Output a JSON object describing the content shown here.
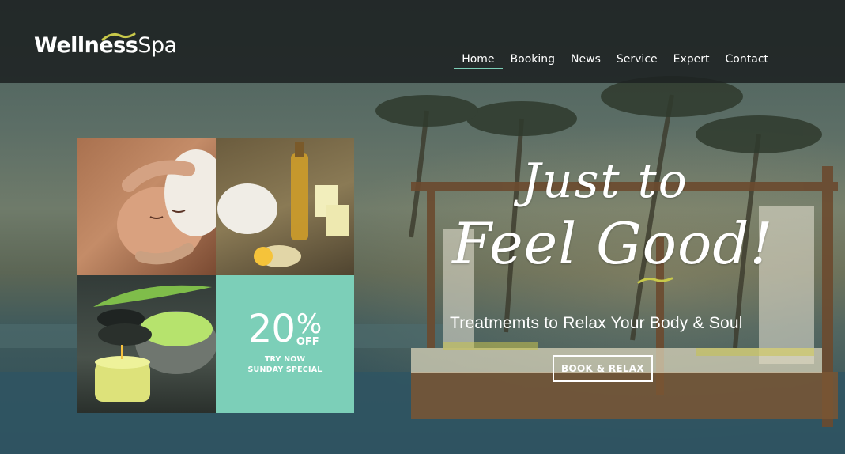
{
  "header": {
    "logo": {
      "bold": "Wellness",
      "light": "Spa"
    },
    "nav": [
      {
        "label": "Home",
        "active": true
      },
      {
        "label": "Booking",
        "active": false
      },
      {
        "label": "News",
        "active": false
      },
      {
        "label": "Service",
        "active": false
      },
      {
        "label": "Expert",
        "active": false
      },
      {
        "label": "Contact",
        "active": false
      }
    ]
  },
  "tiles": {
    "images": [
      "face-massage-photo",
      "spa-oil-candles-photo",
      "bath-salt-stones-photo"
    ],
    "offer": {
      "number": "20",
      "percent": "%",
      "off": "OFF",
      "line1": "TRY NOW",
      "line2": "SUNDAY SPECIAL"
    }
  },
  "hero": {
    "script_line1": "Just to",
    "script_line2": "Feel Good!",
    "tagline": "Treatmemts to Relax Your Body & Soul",
    "cta": "BOOK & RELAX"
  },
  "colors": {
    "accent": "#7ccfb8",
    "logo_swoosh": "#c8c94a",
    "header_bg": "#1e2222"
  }
}
